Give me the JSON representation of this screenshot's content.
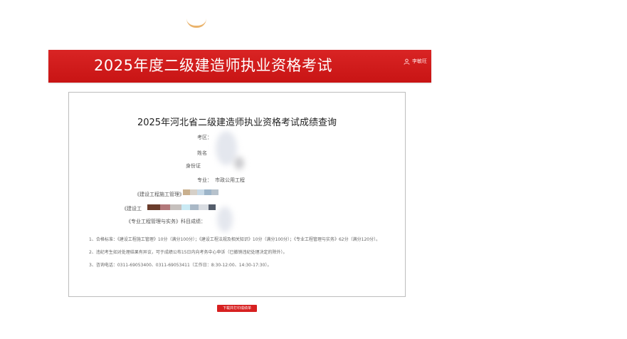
{
  "header": {
    "title": "2025年度二级建造师执业资格考试",
    "user_label": "李敏旺"
  },
  "card": {
    "title": "2025年河北省二级建造师执业资格考试成绩查询",
    "fields": {
      "exam_no_label": "考区：",
      "name_label": "姓名",
      "id_label": "身份证",
      "major_label": "专业：",
      "major_value": "市政公用工程",
      "subject1_label": "《建设工程施工管理》",
      "subject2_label": "《建设工",
      "subject3_label": "《专业工程管理与实务》科目成绩："
    },
    "notes": [
      "1、合格标准：《建设工程施工管理》10分（满分100分）；《建设工程法规及相关知识》10分（满分100分）；《专业工程管理与实务》62分（满分120分）。",
      "2、违纪考生如对处理结果有异议，可于成绩公布15日内向考务中心申诉（已撤销违纪处理决定的除外）。",
      "3、咨询电话：0311-69053400、0311-69053411（工作日：8:30-12:00、14:30-17:30）。"
    ]
  },
  "actions": {
    "download_label": "下载并打印成绩单"
  }
}
